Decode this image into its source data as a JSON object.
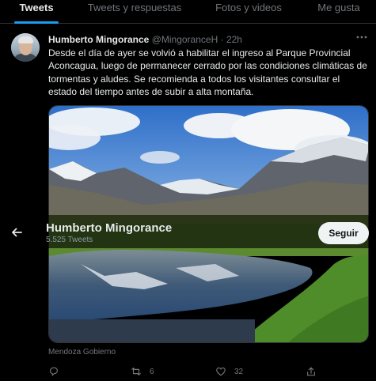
{
  "tabs": [
    {
      "label": "Tweets",
      "active": true
    },
    {
      "label": "Tweets y respuestas",
      "active": false
    },
    {
      "label": "Fotos y videos",
      "active": false
    },
    {
      "label": "Me gusta",
      "active": false
    }
  ],
  "tweet": {
    "author_name": "Humberto Mingorance",
    "author_handle": "@MingoranceH",
    "separator": "·",
    "time": "22h",
    "text": "Desde el día de ayer se volvió a habilitar el ingreso al Parque Provincial Aconcagua, luego de permanecer cerrado por las condiciones climáticas de tormentas y aludes. Se recomienda a todos los visitantes consultar el estado del tiempo antes de subir a alta montaña.",
    "media_caption": "Mendoza Gobierno",
    "media_icon": "mountain-lake-photo",
    "actions": {
      "reply_count": "",
      "retweet_count": "6",
      "like_count": "32",
      "share_count": ""
    }
  },
  "profile_overlay": {
    "name": "Humberto Mingorance",
    "tweet_count": "5.525 Tweets",
    "follow_label": "Seguir",
    "back_icon": "arrow-left-icon"
  },
  "colors": {
    "background": "#000000",
    "accent": "#1d9bf0",
    "text_primary": "#e7e9ea",
    "text_secondary": "#71767b"
  }
}
